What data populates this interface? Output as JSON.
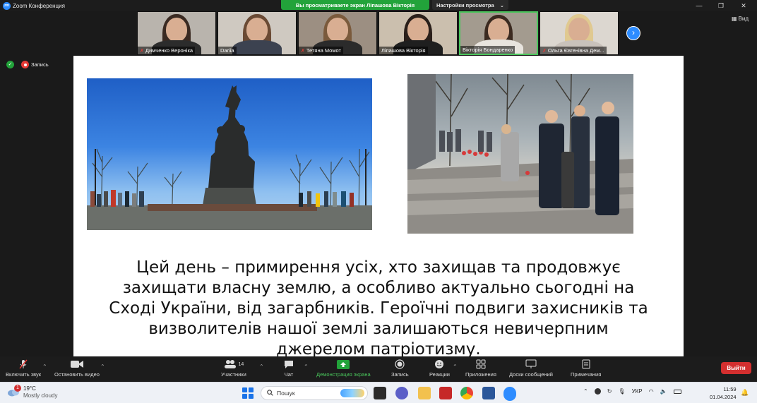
{
  "window": {
    "app_title": "Zoom Конференция",
    "logo_text": "zm"
  },
  "share_banner": {
    "text": "Вы просматриваете экран Лiпашова Вiкторiя",
    "view_options": "Настройки просмотра"
  },
  "view_button": {
    "label": "Вид"
  },
  "participants": [
    {
      "name": "Димченко Вероніка",
      "muted": true,
      "bg": "#b9b4ad",
      "hair": "#3a2a22",
      "body": "#2c2c2c"
    },
    {
      "name": "Dariia",
      "muted": false,
      "bg": "#cfc9c1",
      "hair": "#6a4a34",
      "body": "#3c4250"
    },
    {
      "name": "Тетяна Момот",
      "muted": true,
      "bg": "#9c8f82",
      "hair": "#7a5a3c",
      "body": "#2b2b2b"
    },
    {
      "name": "Лiпашова Вiкторiя",
      "muted": false,
      "bg": "#cbbfae",
      "hair": "#2a1f1a",
      "body": "#1f1f1f"
    },
    {
      "name": "Вікторія Бондаренко",
      "muted": false,
      "bg": "#a39b8f",
      "hair": "#3b2a20",
      "body": "#e8e4de",
      "active": true
    },
    {
      "name": "Ольга Євгенівна Дем...",
      "muted": true,
      "bg": "#dcd7d0",
      "hair": "#e0c990",
      "body": "#c9c2bb"
    }
  ],
  "indicators": {
    "recording_label": "Запись"
  },
  "slide": {
    "text_lines": [
      "Цей день – примирення усіх, хто захищав та продовжує",
      "захищати власну землю, а особливо актуально сьогодні на",
      "Сході України, від загарбників. Героїчні подвиги захисників та",
      "визволителів нашої землі залишаються невичерпним",
      "джерелом патріотизму."
    ]
  },
  "toolbar": {
    "unmute": "Включить звук",
    "stop_video": "Остановить видео",
    "participants": "Участники",
    "participants_count": "14",
    "chat": "Чат",
    "share_screen": "Демонстрация экрана",
    "record": "Запись",
    "reactions": "Реакции",
    "apps": "Приложения",
    "whiteboards": "Доски сообщений",
    "notes": "Примечания",
    "leave": "Выйти"
  },
  "taskbar": {
    "weather_temp": "19°C",
    "weather_desc": "Mostly cloudy",
    "notification_count": "1",
    "search_placeholder": "Пошук",
    "language": "УКР",
    "time": "11:59",
    "date": "01.04.2024"
  },
  "colors": {
    "zoom_blue": "#2d8cff",
    "share_green": "#22a33a",
    "leave_red": "#d32f2f"
  }
}
